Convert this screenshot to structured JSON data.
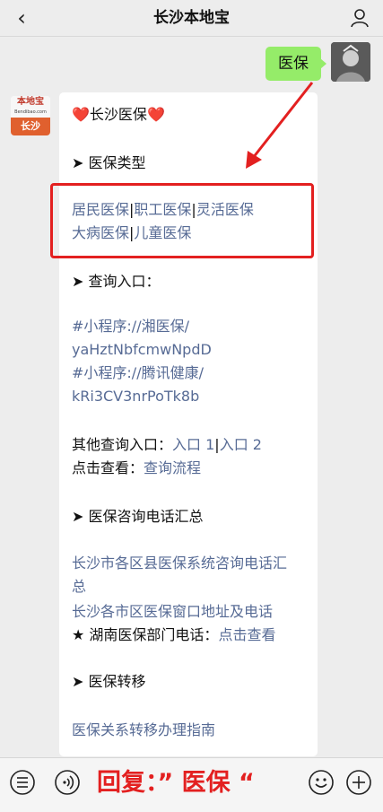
{
  "header": {
    "back_glyph": "‹",
    "title": "长沙本地宝",
    "user_icon": "person-icon"
  },
  "chat": {
    "user_message": "医保",
    "bot_avatar": {
      "brand": "本地宝",
      "brand_sub": "Bendibao.com",
      "city": "长沙"
    },
    "bot_message": {
      "heading_heart_left": "❤️",
      "heading": "长沙医保",
      "heading_heart_right": "❤️",
      "section_types": "➤ 医保类型",
      "types_row1": [
        "居民医保",
        "职工医保",
        "灵活医保"
      ],
      "types_row2": [
        "大病医保",
        "儿童医保"
      ],
      "separator": "|",
      "section_query": "➤ 查询入口：",
      "mini1_line1": "#小程序://湘医保/",
      "mini1_line2": "yaHztNbfcmwNpdD",
      "mini2_line1": "#小程序://腾讯健康/",
      "mini2_line2": "kRi3CV3nrPoTk8b",
      "other_query_label": "其他查询入口：",
      "entry1": "入口 1",
      "entry2": "入口 2",
      "view_label": "点击查看：",
      "view_link": "查询流程",
      "section_phone": "➤ 医保咨询电话汇总",
      "phone_link1_line1": "长沙市各区县医保系统咨询电话汇",
      "phone_link1_line2": "总",
      "phone_link2": "长沙各市区医保窗口地址及电话",
      "hunan_label": "★ 湖南医保部门电话：",
      "hunan_link": "点击查看",
      "section_transfer": "➤ 医保转移",
      "transfer_link": "医保关系转移办理指南"
    }
  },
  "bottombar": {
    "left_icon": "menu-list-icon",
    "voice_icon": "voice-icon",
    "reply_text": "回复：” 医保 “",
    "emoji_icon": "emoji-icon",
    "plus_icon": "plus-icon"
  },
  "colors": {
    "background": "#ededed",
    "user_bubble": "#95ec69",
    "link": "#576b95",
    "annotation_red": "#e32020",
    "bot_avatar_orange": "#e0602e"
  }
}
